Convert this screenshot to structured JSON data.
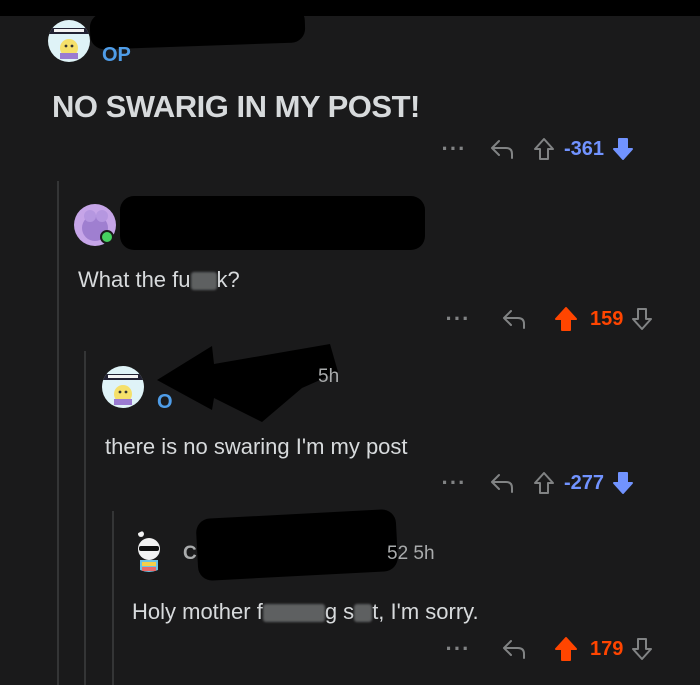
{
  "post": {
    "op_tag": "OP",
    "title": "NO SWARIG IN MY POST!",
    "score": "-361"
  },
  "comment1": {
    "body_a": "What the fu",
    "body_b": "k?",
    "score": "159"
  },
  "comment2": {
    "time": "5h",
    "op_tag": "O",
    "body": "there is no swaring I'm my post",
    "score": "-277"
  },
  "comment3": {
    "username_start": "C",
    "meta": "52 5h",
    "body_a": "Holy mother f",
    "body_b": "g s",
    "body_c": "t, I'm sorry.",
    "score": "179"
  },
  "colors": {
    "background": "#1a1a1b",
    "upvote": "#ff4500",
    "downvote": "#7193ff",
    "op": "#4f9de8"
  },
  "icons": [
    "more-icon",
    "reply-icon",
    "upvote-icon",
    "downvote-icon"
  ]
}
